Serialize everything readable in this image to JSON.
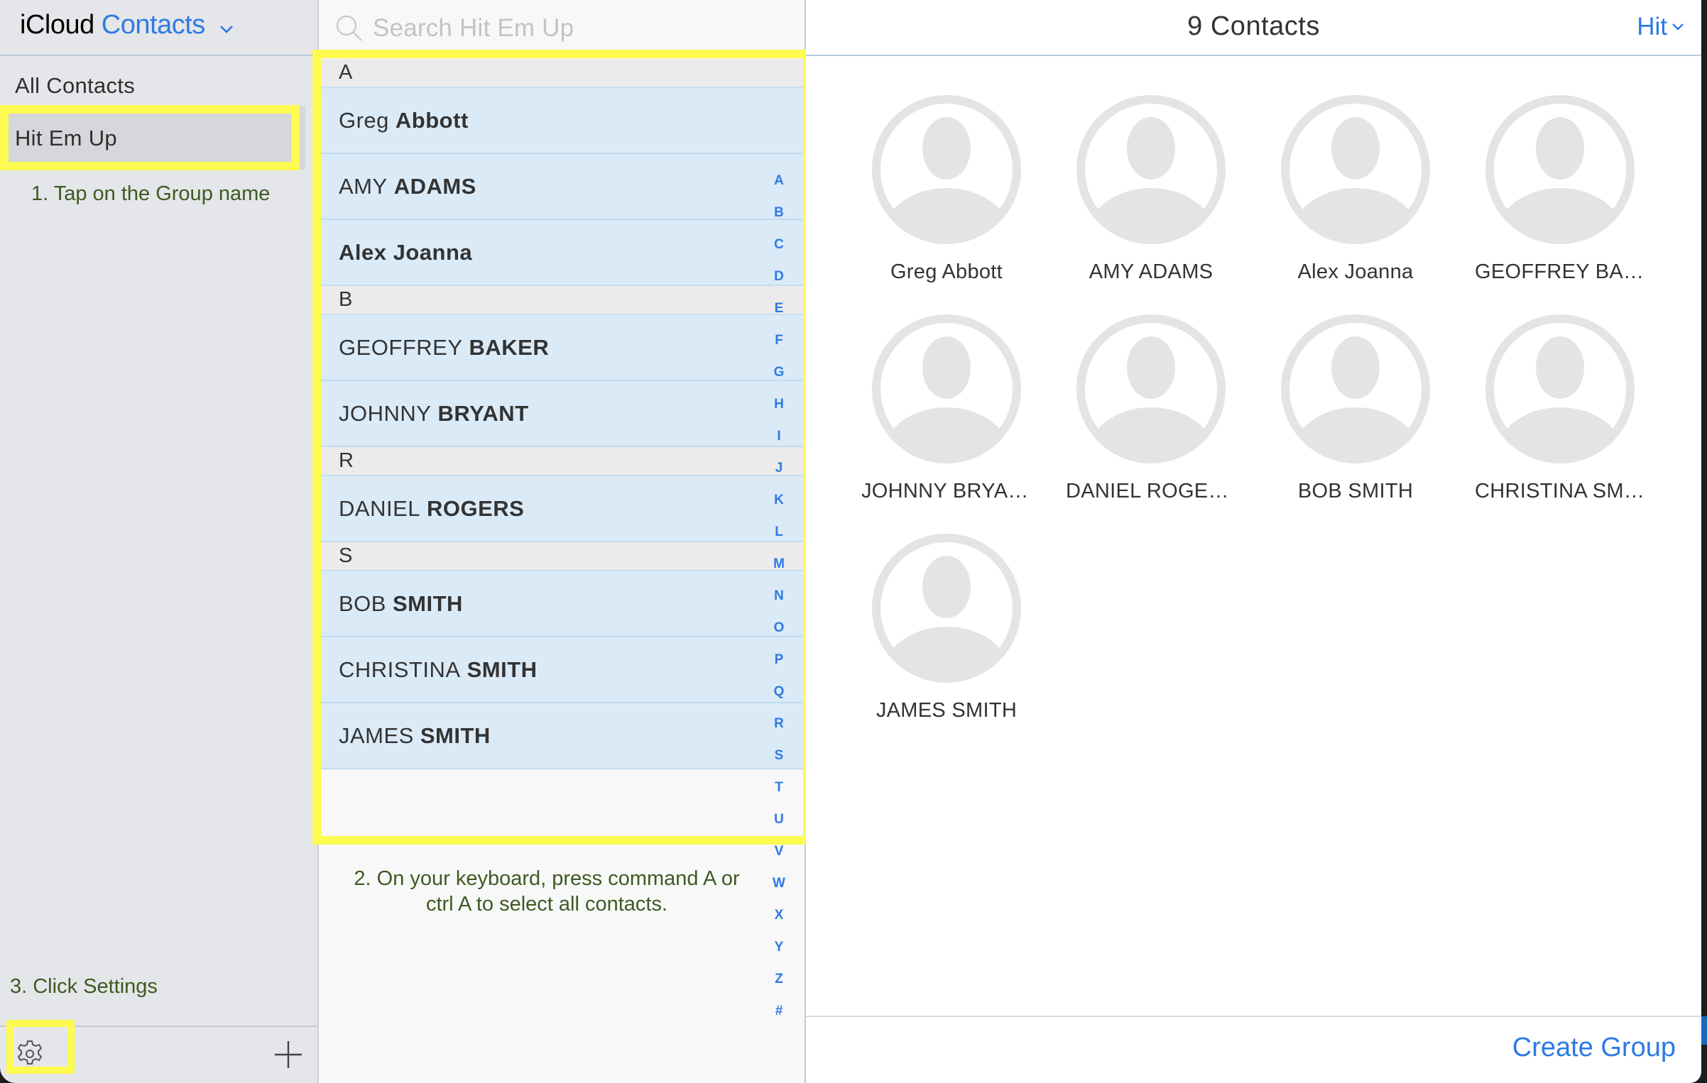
{
  "sidebar": {
    "app_title_prefix": "iCloud",
    "app_title_app": "Contacts",
    "items": [
      {
        "label": "All Contacts",
        "selected": false
      },
      {
        "label": "Hit Em Up",
        "selected": true
      }
    ],
    "settings_icon": "gear-icon",
    "add_icon": "plus-icon"
  },
  "annotations": {
    "step1": "1. Tap on the Group name",
    "step2": "2. On your keyboard, press command A or ctrl A to select all contacts.",
    "step3": "3. Click Settings",
    "highlight_color": "#fdfa50",
    "text_color": "#3e5a22"
  },
  "list": {
    "search_placeholder": "Search Hit Em Up",
    "sections": [
      {
        "letter": "A",
        "contacts": [
          {
            "first": "Greg",
            "last": "Abbott"
          },
          {
            "first": "AMY",
            "last": "ADAMS"
          },
          {
            "first": "",
            "last": "Alex Joanna"
          }
        ]
      },
      {
        "letter": "B",
        "contacts": [
          {
            "first": "GEOFFREY",
            "last": "BAKER"
          },
          {
            "first": "JOHNNY",
            "last": "BRYANT"
          }
        ]
      },
      {
        "letter": "R",
        "contacts": [
          {
            "first": "DANIEL",
            "last": "ROGERS"
          }
        ]
      },
      {
        "letter": "S",
        "contacts": [
          {
            "first": "BOB",
            "last": "SMITH"
          },
          {
            "first": "CHRISTINA",
            "last": "SMITH"
          },
          {
            "first": "JAMES",
            "last": "SMITH"
          }
        ]
      }
    ],
    "index_letters": [
      "A",
      "B",
      "C",
      "D",
      "E",
      "F",
      "G",
      "H",
      "I",
      "J",
      "K",
      "L",
      "M",
      "N",
      "O",
      "P",
      "Q",
      "R",
      "S",
      "T",
      "U",
      "V",
      "W",
      "X",
      "Y",
      "Z",
      "#"
    ]
  },
  "main": {
    "count_label": "9 Contacts",
    "group_selector": "Hit",
    "cards": [
      "Greg Abbott",
      "AMY ADAMS",
      "Alex Joanna",
      "GEOFFREY BAKER",
      "JOHNNY BRYANT",
      "DANIEL ROGERS",
      "BOB SMITH",
      "CHRISTINA SMITH",
      "JAMES SMITH"
    ],
    "create_group_label": "Create Group"
  },
  "colors": {
    "accent": "#2d7ae5",
    "selected_row": "#dbeaf7",
    "sidebar_bg": "#e5e6e9"
  }
}
